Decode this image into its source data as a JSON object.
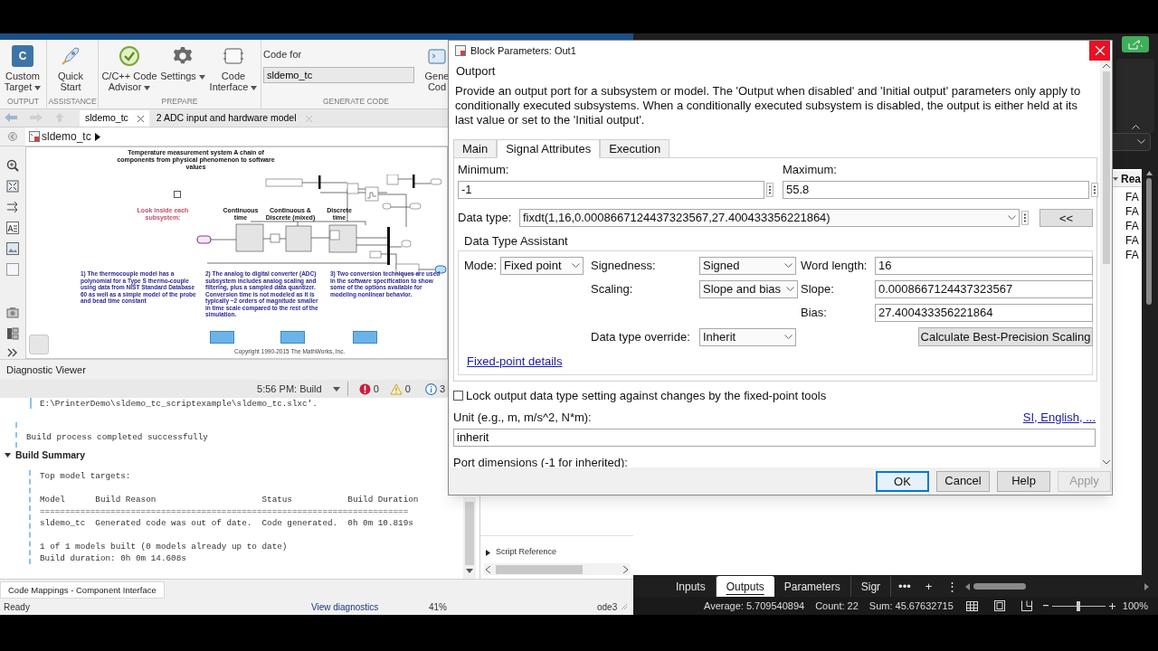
{
  "simulink": {
    "toolbar": [
      {
        "label": "OUTPUT",
        "buttons": [
          {
            "kind": "custom-target",
            "label": "Custom Target",
            "badge": "C",
            "dropdown": true
          }
        ]
      },
      {
        "label": "ASSISTANCE",
        "buttons": [
          {
            "kind": "quick-start",
            "label": "Quick Start",
            "dropdown": false
          }
        ]
      },
      {
        "label": "PREPARE",
        "buttons": [
          {
            "kind": "advisor",
            "label": "C/C++ Code Advisor",
            "dropdown": true
          },
          {
            "kind": "settings",
            "label": "Settings",
            "dropdown": true
          },
          {
            "kind": "interface",
            "label": "Code Interface",
            "dropdown": true
          }
        ]
      },
      {
        "label": "GENERATE CODE",
        "code_for": {
          "label": "Code for",
          "value": "sldemo_tc"
        },
        "buttons": [
          {
            "kind": "generate",
            "label": "Gene Cod",
            "dropdown": false
          }
        ]
      }
    ],
    "tabs": [
      {
        "label": "sldemo_tc",
        "selected": true
      },
      {
        "label": "2 ADC  input and hardware model",
        "selected": false
      }
    ],
    "breadcrumb": "sldemo_tc",
    "diagram": {
      "title": "Temperature measurement system A chain of components from physical phenomenon to software values",
      "hint": "Look inside each subsystem:",
      "stages": [
        "Continuous time",
        "Continuous & Discrete (mixed)",
        "Discrete time"
      ],
      "notes": [
        "1) The thermocouple model has a polynomial for a Type S thermo-couple using data from NIST Standard Database 60 as well as a simple model of the probe and bead time constant",
        "2) The analog to digital converter (ADC) subsystem includes analog scaling and filtering, plus a sampled data quantizer. Conversion time is not modeled as it is typically ~2 orders of magnitude smaller in time scale compared to the rest of the simulation.",
        "3) Two conversion techniques are used in the software specification to show some of the options available for modeling nonlinear behavior."
      ],
      "copyright": "Copyright 1990-2015 The MathWorks, Inc."
    },
    "diagnostics": {
      "title": "Diagnostic Viewer",
      "run": "5:56 PM: Build",
      "errors": "0",
      "warnings": "0",
      "infos": "3",
      "cut_line": "E:\\PrinterDemo\\sldemo_tc_scriptexample\\sldemo_tc.slxc'.",
      "result": "Build process completed successfully",
      "section": {
        "title": "Build Summary",
        "expanded": true,
        "groups": [
          [
            "Top model targets:"
          ],
          [
            "Model      Build Reason                     Status           Build Duration",
            "=========================================================================",
            "sldemo_tc  Generated code was out of date.  Code generated.  0h 0m 10.819s"
          ],
          [
            "1 of 1 models built (0 models already up to date)",
            "Build duration: 0h 0m 14.608s"
          ]
        ]
      }
    },
    "side_panel": {
      "item": "Script Reference",
      "expanded": false
    },
    "bottom_tab": "Code Mappings - Component Interface",
    "status": {
      "state": "Ready",
      "link": "View diagnostics",
      "zoom": "41%",
      "solver": "ode3"
    }
  },
  "dialog": {
    "title": "Block Parameters: Out1",
    "heading": "Outport",
    "description": "Provide an output port for a subsystem or model.  The 'Output when disabled' and 'Initial output' parameters only apply to conditionally executed subsystems. When a conditionally executed subsystem is disabled, the output is either held at its last value or set to the 'Initial output'.",
    "tabs": [
      {
        "label": "Main",
        "selected": false
      },
      {
        "label": "Signal Attributes",
        "selected": true
      },
      {
        "label": "Execution",
        "selected": false
      }
    ],
    "minimum": {
      "label": "Minimum:",
      "value": "-1"
    },
    "maximum": {
      "label": "Maximum:",
      "value": "55.8"
    },
    "data_type": {
      "label": "Data type:",
      "value": "fixdt(1,16,0.0008667124437323567,27.400433356221864)",
      "toggle": "<<"
    },
    "assistant": {
      "title": "Data Type Assistant",
      "mode": {
        "label": "Mode:",
        "value": "Fixed point"
      },
      "signedness": {
        "label": "Signedness:",
        "value": "Signed"
      },
      "word_length": {
        "label": "Word length:",
        "value": "16"
      },
      "scaling": {
        "label": "Scaling:",
        "value": "Slope and bias"
      },
      "slope": {
        "label": "Slope:",
        "value": "0.0008667124437323567"
      },
      "bias": {
        "label": "Bias:",
        "value": "27.400433356221864"
      },
      "override": {
        "label": "Data type override:",
        "value": "Inherit"
      },
      "calculate": "Calculate Best-Precision Scaling",
      "details_link": "Fixed-point details"
    },
    "lock": {
      "label": "Lock output data type setting against changes by the fixed-point tools",
      "checked": false
    },
    "unit": {
      "label": "Unit (e.g., m, m/s^2, N*m):",
      "link": "SI, English, ...",
      "value": "inherit"
    },
    "port_dimensions": "Port dimensions (-1 for inherited):",
    "buttons": [
      {
        "label": "OK",
        "default": true,
        "disabled": false
      },
      {
        "label": "Cancel",
        "default": false,
        "disabled": false
      },
      {
        "label": "Help",
        "default": false,
        "disabled": false
      },
      {
        "label": "Apply",
        "default": false,
        "disabled": true
      }
    ]
  },
  "spreadsheet": {
    "column": "Rea",
    "cells": [
      "FA",
      "FA",
      "FA",
      "FA",
      "FA"
    ],
    "sheets": [
      {
        "label": "Inputs",
        "selected": false
      },
      {
        "label": "Outputs",
        "selected": true
      },
      {
        "label": "Parameters",
        "selected": false
      },
      {
        "label": "Sigr",
        "selected": false
      }
    ],
    "sheet_controls": [
      "•••",
      "+",
      "⋮"
    ],
    "status": {
      "average": "Average: 5.709540894",
      "count": "Count: 22",
      "sum": "Sum: 45.67632715",
      "zoom": "100%"
    },
    "zoom_slider": {
      "level": 0.5
    }
  }
}
